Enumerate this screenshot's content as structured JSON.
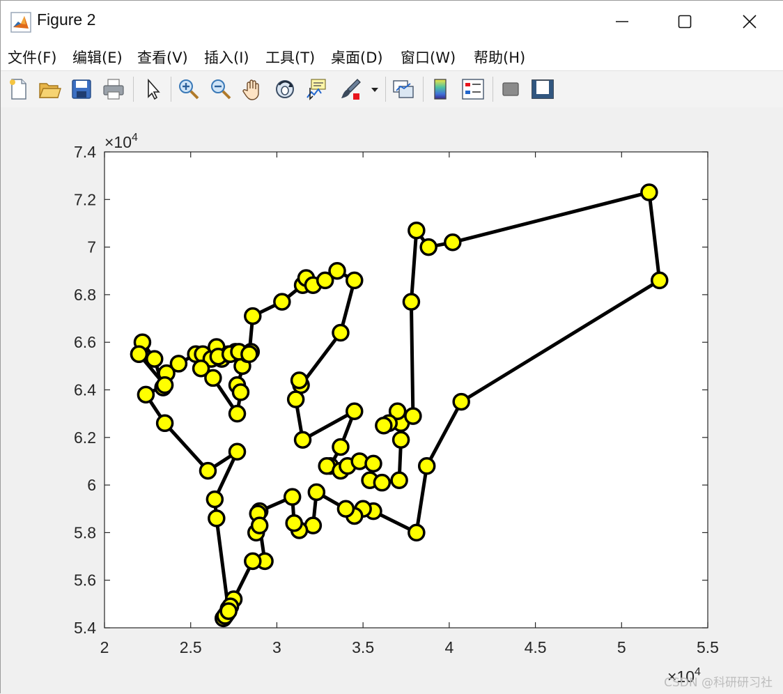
{
  "window": {
    "title": "Figure 2",
    "icon": "matlab-logo-icon",
    "controls": [
      "minimize-icon",
      "maximize-icon",
      "close-icon"
    ]
  },
  "menu": [
    {
      "label": "文件(F)"
    },
    {
      "label": "编辑(E)"
    },
    {
      "label": "查看(V)"
    },
    {
      "label": "插入(I)"
    },
    {
      "label": "工具(T)"
    },
    {
      "label": "桌面(D)"
    },
    {
      "label": "窗口(W)"
    },
    {
      "label": "帮助(H)"
    }
  ],
  "toolbar": [
    "new-figure-icon",
    "open-file-icon",
    "save-icon",
    "print-icon",
    "edit-plot-arrow-icon",
    "zoom-in-icon",
    "zoom-out-icon",
    "pan-hand-icon",
    "rotate-3d-icon",
    "data-cursor-icon",
    "brush-icon",
    "brush-dropdown-icon",
    "link-plot-icon",
    "colorbar-icon",
    "legend-icon",
    "hide-plot-tools-icon",
    "show-plot-tools-icon"
  ],
  "watermark": "CSDN @科研研习社",
  "chart_data": {
    "type": "line",
    "marker": "circle",
    "line_color": "#000000",
    "marker_face_color": "#ffff00",
    "marker_edge_color": "#000000",
    "grid": false,
    "xlim": [
      2,
      5.5
    ],
    "ylim": [
      5.4,
      7.4
    ],
    "x_exponent": "×10^4",
    "y_exponent": "×10^4",
    "x_exponent_text": "×10",
    "y_exponent_text": "×10",
    "exponent_power": "4",
    "xticks": [
      "2",
      "2.5",
      "3",
      "3.5",
      "4",
      "4.5",
      "5",
      "5.5"
    ],
    "yticks": [
      "5.4",
      "5.6",
      "5.8",
      "6",
      "6.2",
      "6.4",
      "6.6",
      "6.8",
      "7",
      "7.2",
      "7.4"
    ],
    "x": [
      2.2,
      2.22,
      2.29,
      2.34,
      2.36,
      2.43,
      2.53,
      2.57,
      2.62,
      2.65,
      2.68,
      2.72,
      2.76,
      2.8,
      2.83,
      2.77,
      2.79,
      2.77,
      2.63,
      2.56,
      2.66,
      2.73,
      2.78,
      2.85,
      2.84,
      2.86,
      3.03,
      3.15,
      3.17,
      3.21,
      3.28,
      3.35,
      3.45,
      3.37,
      3.14,
      3.13,
      3.11,
      3.15,
      3.45,
      3.37,
      3.31,
      3.29,
      3.37,
      3.41,
      3.48,
      3.56,
      3.54,
      3.61,
      3.71,
      3.72,
      3.72,
      3.7,
      3.65,
      3.62,
      3.79,
      3.78,
      3.81,
      3.88,
      4.02,
      5.16,
      5.22,
      4.07,
      3.87,
      3.81,
      3.56,
      3.5,
      3.45,
      3.4,
      3.23,
      3.21,
      3.13,
      3.1,
      3.09,
      2.9,
      2.89,
      2.88,
      2.9,
      2.93,
      2.86,
      2.75,
      2.72,
      2.71,
      2.69,
      2.7,
      2.73,
      2.72,
      2.65,
      2.64,
      2.77,
      2.6,
      2.35,
      2.24,
      2.35,
      2.2
    ],
    "y": [
      6.55,
      6.6,
      6.53,
      6.41,
      6.47,
      6.51,
      6.55,
      6.55,
      6.53,
      6.58,
      6.53,
      6.55,
      6.56,
      6.5,
      6.55,
      6.42,
      6.39,
      6.3,
      6.45,
      6.49,
      6.54,
      6.55,
      6.56,
      6.56,
      6.55,
      6.71,
      6.77,
      6.84,
      6.87,
      6.84,
      6.86,
      6.9,
      6.86,
      6.64,
      6.42,
      6.44,
      6.36,
      6.19,
      6.31,
      6.16,
      6.08,
      6.08,
      6.06,
      6.08,
      6.1,
      6.09,
      6.02,
      6.01,
      6.02,
      6.19,
      6.26,
      6.31,
      6.26,
      6.25,
      6.29,
      6.77,
      7.07,
      7.0,
      7.02,
      7.23,
      6.86,
      6.35,
      6.08,
      5.8,
      5.89,
      5.9,
      5.87,
      5.9,
      5.97,
      5.83,
      5.81,
      5.84,
      5.95,
      5.89,
      5.88,
      5.8,
      5.83,
      5.68,
      5.68,
      5.52,
      5.48,
      5.46,
      5.44,
      5.45,
      5.49,
      5.47,
      5.86,
      5.94,
      6.14,
      6.06,
      6.26,
      6.38,
      6.42,
      6.55
    ]
  }
}
